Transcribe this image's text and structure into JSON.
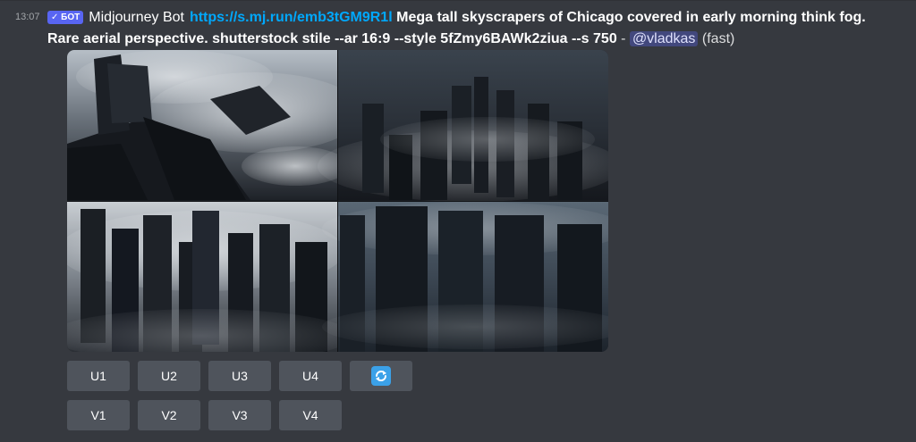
{
  "message": {
    "timestamp": "13:07",
    "badge": "✓ БОТ",
    "author": "Midjourney Bot",
    "link": "https://s.mj.run/emb3tGM9R1l",
    "prompt": "Mega tall skyscrapers of Chicago covered in early morning think fog. Rare aerial perspective. shutterstock stile --ar 16:9 --style 5fZmy6BAWk2ziua --s 750",
    "separator": " - ",
    "mention": "@vladkas",
    "speed": "(fast)"
  },
  "image": {
    "subject": "2x2 grid of foggy aerial skyscraper renders"
  },
  "buttons": {
    "upscale": [
      "U1",
      "U2",
      "U3",
      "U4"
    ],
    "reroll_icon": "refresh-icon",
    "variation": [
      "V1",
      "V2",
      "V3",
      "V4"
    ]
  },
  "colors": {
    "background": "#36393f",
    "button": "#4f545c",
    "link": "#00a8fc",
    "badge": "#5865f2",
    "refresh_icon": "#3ba1e8"
  }
}
